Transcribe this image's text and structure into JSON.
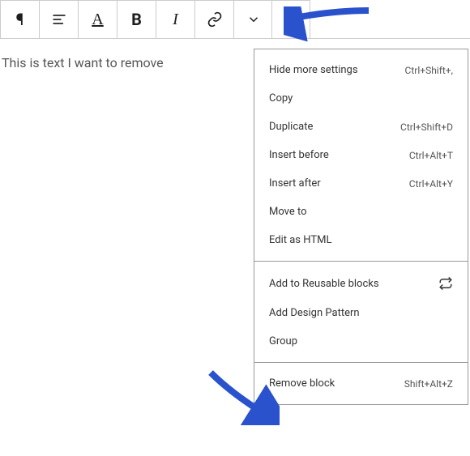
{
  "toolbar": {
    "paragraph_icon": "¶",
    "bold_label": "B",
    "italic_label": "I",
    "color_label": "A"
  },
  "content": {
    "text": "This is text I want to remove"
  },
  "menu": {
    "section1": [
      {
        "label": "Hide more settings",
        "shortcut": "Ctrl+Shift+,"
      },
      {
        "label": "Copy",
        "shortcut": ""
      },
      {
        "label": "Duplicate",
        "shortcut": "Ctrl+Shift+D"
      },
      {
        "label": "Insert before",
        "shortcut": "Ctrl+Alt+T"
      },
      {
        "label": "Insert after",
        "shortcut": "Ctrl+Alt+Y"
      },
      {
        "label": "Move to",
        "shortcut": ""
      },
      {
        "label": "Edit as HTML",
        "shortcut": ""
      }
    ],
    "section2": [
      {
        "label": "Add to Reusable blocks",
        "shortcut": "",
        "icon": "reusable"
      },
      {
        "label": "Add Design Pattern",
        "shortcut": ""
      },
      {
        "label": "Group",
        "shortcut": ""
      }
    ],
    "section3": [
      {
        "label": "Remove block",
        "shortcut": "Shift+Alt+Z"
      }
    ]
  }
}
